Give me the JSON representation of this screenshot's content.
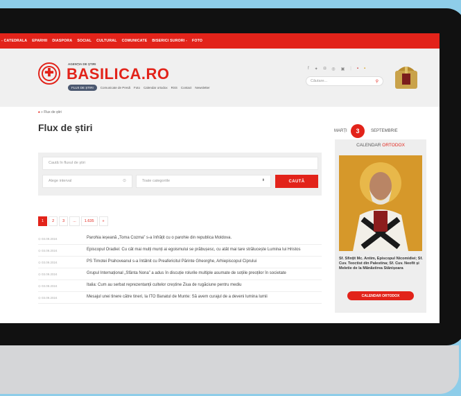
{
  "nav": {
    "items": [
      "- CATEDRALA",
      "EPARHII",
      "DIASPORA",
      "SOCIAL",
      "CULTURAL",
      "COMUNICATE",
      "BISERICI SURORI -",
      "FOTO"
    ]
  },
  "header": {
    "agency": "AGENȚIA DE ȘTIRI",
    "brand": "BASILICA.RO",
    "subnav_active": "FLUX DE ȘTIRI",
    "subnav": [
      "Comunicate de Presă",
      "Foto",
      "Calendar ortodox",
      "RSS",
      "Contact",
      "Newsletter"
    ],
    "search_placeholder": "Căutare...",
    "social_icons": [
      "facebook-icon",
      "twitter-icon",
      "instagram-icon",
      "pinterest-icon",
      "youtube-icon"
    ],
    "flags": [
      "uk-flag-icon",
      "romania-flag-icon"
    ]
  },
  "page": {
    "breadcrumb": "» Flux de știri",
    "title": "Flux de știri"
  },
  "filters": {
    "search_placeholder": "Caută în fluxul de știri",
    "interval_placeholder": "Alege interval",
    "category": "Toate categoriile",
    "button": "CAUTĂ"
  },
  "pagination": [
    "1",
    "2",
    "3",
    "...",
    "1.635",
    "»"
  ],
  "news": [
    {
      "date": "⊙ 03.09.2024",
      "text": "Parohia ieșeană „Toma Cozma” s-a înfrățit cu o parohie din republica Moldova."
    },
    {
      "date": "⊙ 03.09.2024",
      "text": "Episcopul Oradiei: Cu cât mai mulți munți ai egoismului se prăbușesc, cu atât mai tare strălucește Lumina lui Hristos"
    },
    {
      "date": "⊙ 03.09.2024",
      "text": "PS Timotei Prahoveanul s-a întâlnit cu Preafericitul Părinte Gheorghe, Arhiepiscopul Ciprului"
    },
    {
      "date": "⊙ 03.09.2024",
      "text": "Grupul Internațional „Sfânta Nona” a adus în discuție rolurile multiple asumate de soțiile preoților în societate"
    },
    {
      "date": "⊙ 03.09.2024",
      "text": "Italia: Cum au serbat reprezentanții cultelor creștine Ziua de rugăciune pentru mediu"
    },
    {
      "date": "⊙ 03.09.2024",
      "text": "Mesajul unei tinere către tineri, la ITO Banatul de Munte: Să avem curajul de a deveni lumina lumii"
    }
  ],
  "calendar": {
    "weekday": "MARȚI",
    "day": "3",
    "month": "SEPTEMBRIE",
    "title_prefix": "CALENDAR",
    "title_accent": "ORTODOX",
    "saints": "Sf. Sfințit Mc. Antim, Episcopul Nicomidiei; Sf. Cuv. Teoctist din Palestina; Sf. Cuv. Neofit și Meletie de la Mănăstirea Stânișoara",
    "button": "CALENDAR ORTODOX"
  },
  "colors": {
    "accent": "#e2231a",
    "background": "#8ecde9",
    "bezel": "#111111"
  }
}
